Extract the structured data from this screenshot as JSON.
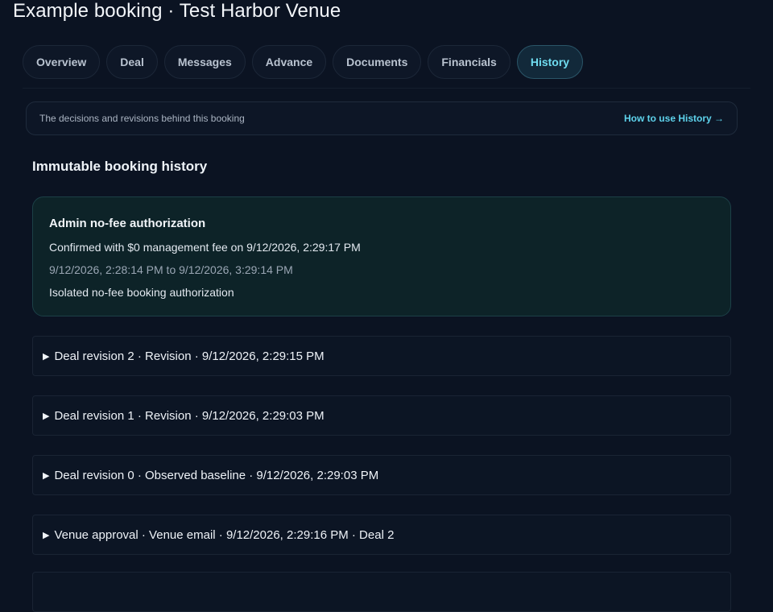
{
  "page": {
    "title": "Example booking · Test Harbor Venue"
  },
  "tabs": [
    {
      "label": "Overview"
    },
    {
      "label": "Deal"
    },
    {
      "label": "Messages"
    },
    {
      "label": "Advance"
    },
    {
      "label": "Documents"
    },
    {
      "label": "Financials"
    },
    {
      "label": "History",
      "active": true
    }
  ],
  "intro": {
    "text": "The decisions and revisions behind this booking",
    "link": "How to use History →"
  },
  "history": {
    "section_title": "Immutable booking history",
    "authorization": {
      "title": "Admin no-fee authorization",
      "confirmed": "Confirmed with $0 management fee on 9/12/2026, 2:29:17 PM",
      "window": "9/12/2026, 2:28:14 PM to 9/12/2026, 3:29:14 PM",
      "note": "Isolated no-fee booking authorization"
    },
    "items": [
      {
        "label": "Deal revision 2 · Revision · 9/12/2026, 2:29:15 PM"
      },
      {
        "label": "Deal revision 1 · Revision · 9/12/2026, 2:29:03 PM"
      },
      {
        "label": "Deal revision 0 · Observed baseline · 9/12/2026, 2:29:03 PM"
      },
      {
        "label": "Venue approval · Venue email · 9/12/2026, 2:29:16 PM · Deal 2"
      }
    ]
  },
  "colors": {
    "background": "#0b1322",
    "accent": "#5ed3ec",
    "card_teal": "#0d2328"
  }
}
